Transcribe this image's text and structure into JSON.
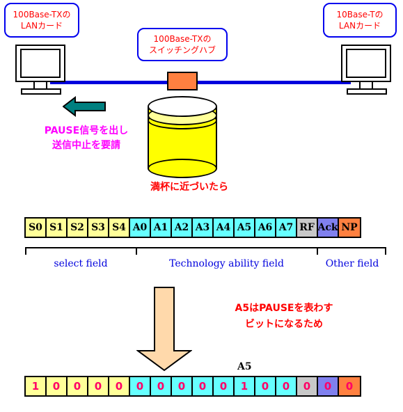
{
  "callouts": {
    "left": {
      "line1": "100Base-TXの",
      "line2": "LANカード"
    },
    "center": {
      "line1": "100Base-TXの",
      "line2": "スイッチングハブ"
    },
    "right": {
      "line1": "10Base-Tの",
      "line2": "LANカード"
    }
  },
  "notes": {
    "pause_line1": "PAUSE信号を出し",
    "pause_line2": "送信中止を要請",
    "buffer_full": "満杯に近づいたら",
    "a5_line1": "A5はPAUSEを表わす",
    "a5_line2": "ビットになるため"
  },
  "bitfield": {
    "cells": [
      {
        "label": "S0",
        "color": "#ffff99",
        "group": "select"
      },
      {
        "label": "S1",
        "color": "#ffff99",
        "group": "select"
      },
      {
        "label": "S2",
        "color": "#ffff99",
        "group": "select"
      },
      {
        "label": "S3",
        "color": "#ffff99",
        "group": "select"
      },
      {
        "label": "S4",
        "color": "#ffff99",
        "group": "select"
      },
      {
        "label": "A0",
        "color": "#66ffff",
        "group": "ability"
      },
      {
        "label": "A1",
        "color": "#66ffff",
        "group": "ability"
      },
      {
        "label": "A2",
        "color": "#66ffff",
        "group": "ability"
      },
      {
        "label": "A3",
        "color": "#66ffff",
        "group": "ability"
      },
      {
        "label": "A4",
        "color": "#66ffff",
        "group": "ability"
      },
      {
        "label": "A5",
        "color": "#66ffff",
        "group": "ability"
      },
      {
        "label": "A6",
        "color": "#66ffff",
        "group": "ability"
      },
      {
        "label": "A7",
        "color": "#66ffff",
        "group": "ability"
      },
      {
        "label": "RF",
        "color": "#c8c8c8",
        "group": "other"
      },
      {
        "label": "Ack",
        "color": "#8080ee",
        "group": "other"
      },
      {
        "label": "NP",
        "color": "#ff8040",
        "group": "other"
      }
    ],
    "field_labels": [
      {
        "text": "select field"
      },
      {
        "text": "Technology ability field"
      },
      {
        "text": "Other field"
      }
    ],
    "values": [
      {
        "value": "1",
        "color": "#ffff99"
      },
      {
        "value": "0",
        "color": "#ffff99"
      },
      {
        "value": "0",
        "color": "#ffff99"
      },
      {
        "value": "0",
        "color": "#ffff99"
      },
      {
        "value": "0",
        "color": "#ffff99"
      },
      {
        "value": "0",
        "color": "#66ffff"
      },
      {
        "value": "0",
        "color": "#66ffff"
      },
      {
        "value": "0",
        "color": "#66ffff"
      },
      {
        "value": "0",
        "color": "#66ffff"
      },
      {
        "value": "0",
        "color": "#66ffff"
      },
      {
        "value": "1",
        "color": "#66ffff"
      },
      {
        "value": "0",
        "color": "#66ffff"
      },
      {
        "value": "0",
        "color": "#66ffff"
      },
      {
        "value": "0",
        "color": "#c8c8c8"
      },
      {
        "value": "0",
        "color": "#8080ee"
      },
      {
        "value": "0",
        "color": "#ff8040"
      }
    ],
    "marker_label": "A5"
  },
  "colors": {
    "callout_border": "#0000ee",
    "callout_text": "#ff0000",
    "cable": "#0000dd",
    "hub": "#ff8040",
    "buffer": "#ffff00",
    "pause_arrow": "#008080",
    "down_arrow": "#ffd9ab",
    "bit_value": "#ff0066",
    "field_label": "#0000dd",
    "magenta_note": "#ff00ff",
    "red_note": "#ff0000"
  }
}
